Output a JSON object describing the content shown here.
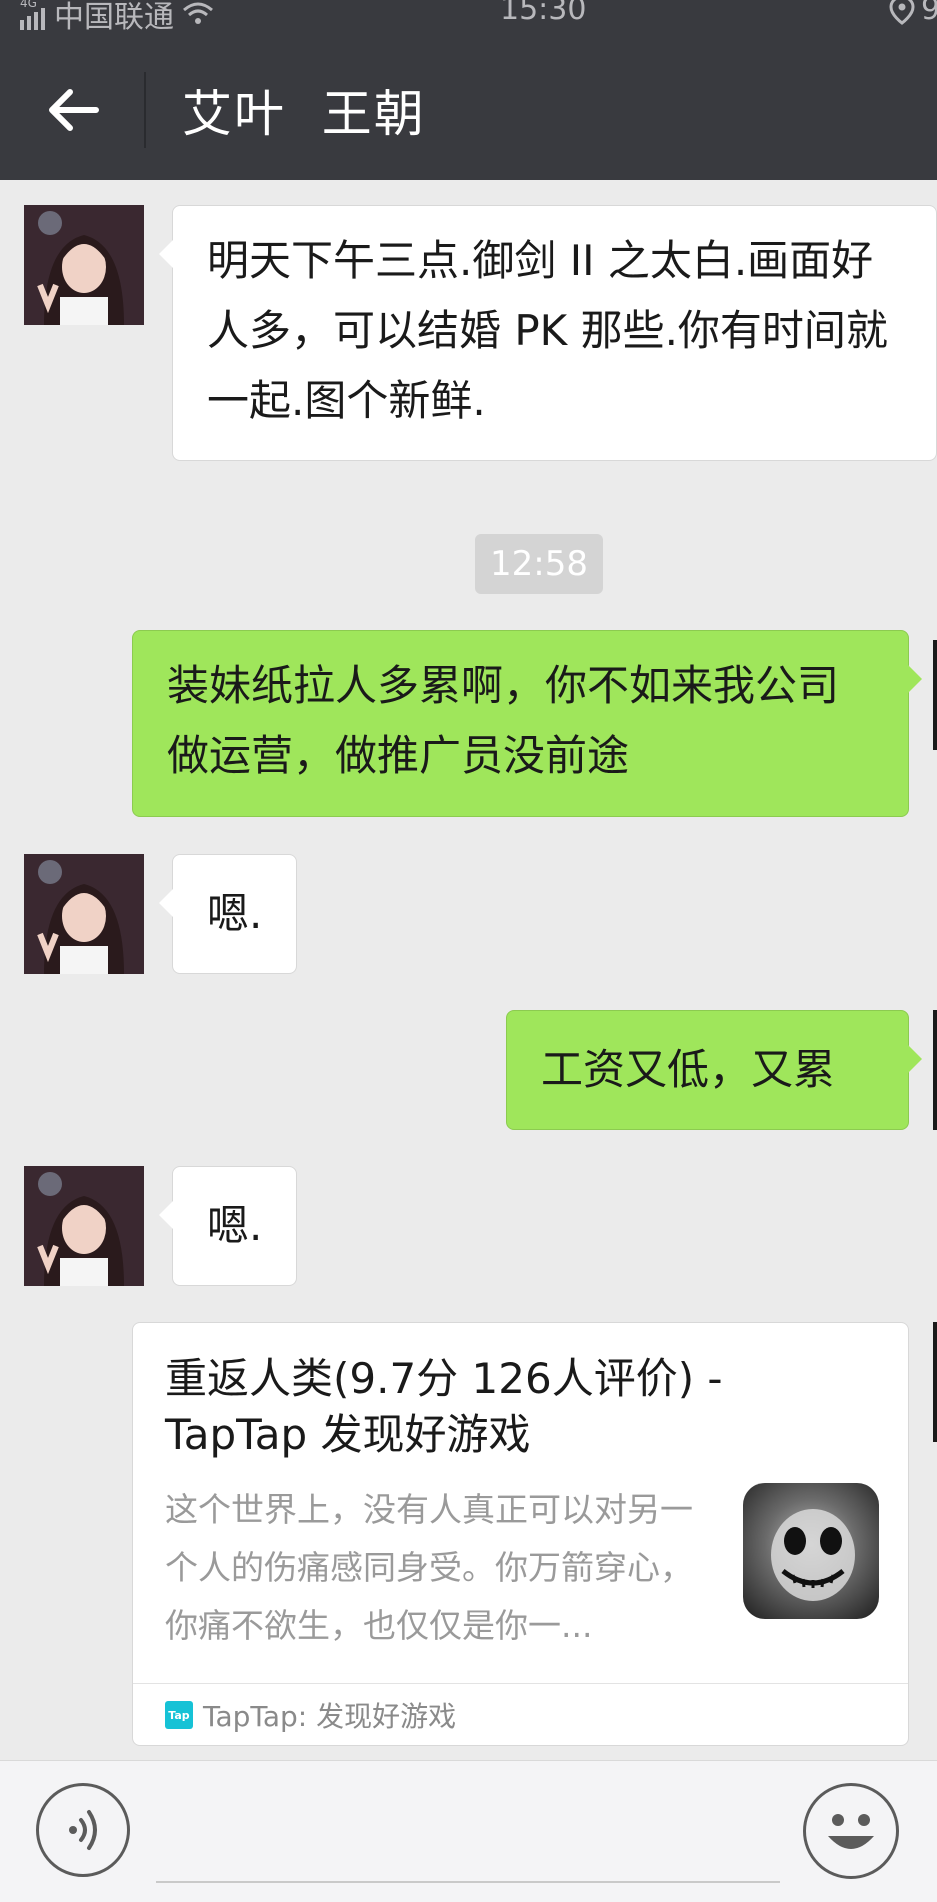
{
  "status_bar": {
    "network": "4G",
    "carrier": "中国联通",
    "time": "15:30",
    "battery_partial": "9"
  },
  "nav": {
    "title": "艾叶  王朝"
  },
  "messages": [
    {
      "side": "in",
      "text": "明天下午三点.御剑 II 之太白.画面好人多，可以结婚 PK 那些.你有时间就一起.图个新鲜."
    },
    {
      "side": "out",
      "text": "装妹纸拉人多累啊，你不如来我公司做运营，做推广员没前途"
    },
    {
      "side": "in",
      "text": "嗯."
    },
    {
      "side": "out",
      "text": "工资又低，又累"
    },
    {
      "side": "in",
      "text": "嗯."
    }
  ],
  "timestamp": "12:58",
  "link_card": {
    "title": "重返人类(9.7分 126人评价) - TapTap 发现好游戏",
    "description": "这个世界上，没有人真正可以对另一个人的伤痛感同身受。你万箭穿心，你痛不欲生，也仅仅是你一...",
    "logo_text": "Tap",
    "source": "TapTap: 发现好游戏"
  },
  "colors": {
    "header_bg": "#393a3f",
    "chat_bg": "#ebebeb",
    "outgoing_bubble": "#9fe65b",
    "incoming_bubble": "#ffffff",
    "taptap_accent": "#16c2d6"
  },
  "icons": {
    "back": "arrow-left",
    "voice": "voice-wave",
    "emoji": "smiley-face"
  }
}
